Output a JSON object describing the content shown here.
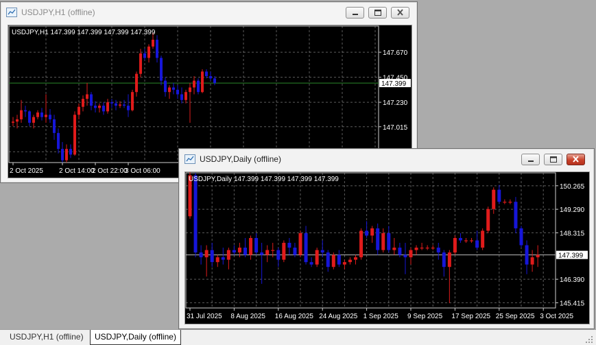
{
  "colors": {
    "bull": "#e01b1b",
    "bear": "#1616d8",
    "grid": "#a8a8a8",
    "text": "#ffffff",
    "price_line": "#2a8a2a",
    "background": "#000000"
  },
  "icons": {
    "window": "chart-window-icon",
    "minimize": "minimize-icon",
    "maximize": "maximize-icon",
    "close": "close-icon"
  },
  "window1": {
    "title": "USDJPY,H1 (offline)",
    "chart_label": "USDJPY,H1  147.399 147.399 147.399 147.399"
  },
  "window2": {
    "title": "USDJPY,Daily (offline)",
    "chart_label": "USDJPY,Daily  147.399 147.399 147.399 147.399"
  },
  "tabs": [
    {
      "label": "USDJPY,H1 (offline)",
      "active": false
    },
    {
      "label": "USDJPY,Daily (offline)",
      "active": true
    }
  ],
  "chart_data": [
    {
      "type": "candlestick",
      "symbol": "USDJPY",
      "timeframe": "H1",
      "ylim": [
        146.7,
        147.9
      ],
      "y_ticks": [
        "147.670",
        "147.450",
        "147.230",
        "147.015",
        "146.795"
      ],
      "y_tick_values": [
        147.67,
        147.45,
        147.23,
        147.015,
        146.795
      ],
      "x_ticks": [
        "2 Oct 2025",
        "2 Oct 14:00",
        "2 Oct 22:00",
        "3 Oct 06:00"
      ],
      "x_tick_index": [
        0,
        12,
        20,
        28
      ],
      "current_price": 147.399,
      "current_price_label": "147.399",
      "grid": true,
      "candles": [
        [
          147.05,
          147.1,
          147.02,
          147.06
        ],
        [
          147.06,
          147.12,
          147.0,
          147.08
        ],
        [
          147.08,
          147.25,
          147.05,
          147.16
        ],
        [
          147.16,
          147.2,
          147.1,
          147.15
        ],
        [
          147.15,
          147.16,
          147.02,
          147.05
        ],
        [
          147.05,
          147.12,
          147.0,
          147.1
        ],
        [
          147.1,
          147.16,
          147.08,
          147.14
        ],
        [
          147.14,
          147.18,
          147.07,
          147.1
        ],
        [
          147.1,
          147.3,
          147.05,
          147.12
        ],
        [
          147.12,
          147.17,
          147.05,
          147.08
        ],
        [
          147.08,
          147.12,
          146.9,
          146.96
        ],
        [
          146.96,
          147.0,
          146.78,
          146.82
        ],
        [
          146.82,
          146.88,
          146.68,
          146.72
        ],
        [
          146.72,
          146.86,
          146.7,
          146.82
        ],
        [
          146.82,
          146.86,
          146.74,
          146.77
        ],
        [
          146.77,
          147.15,
          146.76,
          147.12
        ],
        [
          147.12,
          147.22,
          147.08,
          147.19
        ],
        [
          147.19,
          147.29,
          147.15,
          147.26
        ],
        [
          147.26,
          147.4,
          147.2,
          147.3
        ],
        [
          147.3,
          147.32,
          147.16,
          147.2
        ],
        [
          147.2,
          147.24,
          147.14,
          147.18
        ],
        [
          147.18,
          147.22,
          147.14,
          147.2
        ],
        [
          147.2,
          147.23,
          147.12,
          147.15
        ],
        [
          147.15,
          147.26,
          147.13,
          147.23
        ],
        [
          147.23,
          147.26,
          147.18,
          147.22
        ],
        [
          147.22,
          147.25,
          147.16,
          147.2
        ],
        [
          147.2,
          147.24,
          147.18,
          147.21
        ],
        [
          147.21,
          147.25,
          147.18,
          147.2
        ],
        [
          147.2,
          147.3,
          147.1,
          147.16
        ],
        [
          147.16,
          147.34,
          147.15,
          147.32
        ],
        [
          147.32,
          147.5,
          147.28,
          147.48
        ],
        [
          147.48,
          147.7,
          147.45,
          147.66
        ],
        [
          147.66,
          147.7,
          147.6,
          147.62
        ],
        [
          147.62,
          147.74,
          147.58,
          147.72
        ],
        [
          147.72,
          147.84,
          147.7,
          147.78
        ],
        [
          147.78,
          147.82,
          147.58,
          147.62
        ],
        [
          147.62,
          147.64,
          147.38,
          147.42
        ],
        [
          147.42,
          147.45,
          147.28,
          147.32
        ],
        [
          147.32,
          147.38,
          147.26,
          147.36
        ],
        [
          147.36,
          147.4,
          147.3,
          147.34
        ],
        [
          147.34,
          147.38,
          147.26,
          147.3
        ],
        [
          147.3,
          147.36,
          147.22,
          147.25
        ],
        [
          147.25,
          147.34,
          147.22,
          147.32
        ],
        [
          147.32,
          147.4,
          147.05,
          147.36
        ],
        [
          147.36,
          147.46,
          147.3,
          147.42
        ],
        [
          147.42,
          147.44,
          147.3,
          147.32
        ],
        [
          147.32,
          147.52,
          147.31,
          147.5
        ],
        [
          147.5,
          147.52,
          147.44,
          147.46
        ],
        [
          147.46,
          147.5,
          147.42,
          147.44
        ],
        [
          147.44,
          147.46,
          147.38,
          147.4
        ]
      ]
    },
    {
      "type": "candlestick",
      "symbol": "USDJPY",
      "timeframe": "Daily",
      "ylim": [
        145.2,
        150.8
      ],
      "y_ticks": [
        "150.265",
        "149.290",
        "148.315",
        "146.390",
        "145.415"
      ],
      "y_tick_values": [
        150.265,
        149.29,
        148.315,
        146.39,
        145.415
      ],
      "x_ticks": [
        "31 Jul 2025",
        "8 Aug 2025",
        "16 Aug 2025",
        "24 Aug 2025",
        "1 Sep 2025",
        "9 Sep 2025",
        "17 Sep 2025",
        "25 Sep 2025",
        "3 Oct 2025"
      ],
      "x_tick_index": [
        0,
        8,
        16,
        24,
        32,
        40,
        48,
        56,
        64
      ],
      "current_price": 147.399,
      "current_price_label": "147.399",
      "grid": true,
      "candles": [
        [
          149.0,
          150.9,
          148.9,
          150.7
        ],
        [
          150.7,
          150.8,
          147.3,
          147.5
        ],
        [
          147.5,
          147.8,
          147.0,
          147.3
        ],
        [
          147.3,
          147.8,
          146.5,
          147.6
        ],
        [
          147.6,
          147.9,
          146.9,
          147.1
        ],
        [
          147.1,
          147.4,
          146.9,
          147.3
        ],
        [
          147.3,
          147.7,
          147.0,
          147.2
        ],
        [
          147.2,
          147.7,
          146.8,
          147.6
        ],
        [
          147.6,
          147.8,
          147.4,
          147.5
        ],
        [
          147.5,
          147.9,
          147.3,
          147.7
        ],
        [
          147.7,
          148.1,
          147.3,
          147.4
        ],
        [
          147.4,
          148.2,
          147.2,
          148.1
        ],
        [
          148.1,
          148.3,
          147.4,
          147.5
        ],
        [
          147.5,
          147.9,
          146.2,
          147.4
        ],
        [
          147.4,
          147.8,
          147.1,
          147.6
        ],
        [
          147.6,
          147.9,
          147.3,
          147.6
        ],
        [
          147.6,
          147.7,
          146.9,
          147.2
        ],
        [
          147.2,
          148.0,
          147.1,
          147.9
        ],
        [
          147.9,
          148.1,
          147.4,
          147.7
        ],
        [
          147.7,
          147.9,
          147.3,
          147.4
        ],
        [
          147.4,
          148.4,
          147.3,
          148.3
        ],
        [
          148.3,
          148.6,
          147.0,
          147.1
        ],
        [
          147.1,
          147.3,
          146.9,
          147.0
        ],
        [
          147.0,
          147.7,
          146.9,
          147.6
        ],
        [
          147.6,
          148.0,
          147.3,
          147.5
        ],
        [
          147.5,
          147.6,
          146.7,
          146.9
        ],
        [
          146.9,
          147.5,
          146.8,
          147.4
        ],
        [
          147.4,
          147.6,
          146.9,
          147.0
        ],
        [
          147.0,
          147.2,
          146.8,
          147.1
        ],
        [
          147.1,
          147.3,
          147.0,
          147.2
        ],
        [
          147.2,
          147.4,
          147.0,
          147.3
        ],
        [
          147.3,
          148.5,
          147.2,
          148.4
        ],
        [
          148.4,
          148.8,
          148.1,
          148.2
        ],
        [
          148.2,
          148.6,
          147.9,
          148.5
        ],
        [
          148.5,
          148.7,
          147.4,
          147.6
        ],
        [
          147.6,
          148.5,
          147.5,
          148.3
        ],
        [
          148.3,
          148.6,
          147.5,
          147.6
        ],
        [
          147.6,
          148.1,
          147.4,
          147.7
        ],
        [
          147.7,
          147.9,
          147.3,
          147.4
        ],
        [
          147.4,
          147.9,
          146.6,
          147.3
        ],
        [
          147.3,
          147.7,
          147.0,
          147.6
        ],
        [
          147.6,
          147.8,
          147.4,
          147.7
        ],
        [
          147.7,
          147.9,
          147.6,
          147.7
        ],
        [
          147.7,
          147.8,
          147.6,
          147.7
        ],
        [
          147.7,
          147.8,
          147.6,
          147.7
        ],
        [
          147.7,
          147.9,
          147.2,
          147.5
        ],
        [
          147.5,
          147.6,
          146.5,
          146.9
        ],
        [
          146.9,
          147.6,
          145.4,
          147.5
        ],
        [
          147.5,
          148.2,
          147.4,
          148.1
        ],
        [
          148.1,
          148.3,
          147.9,
          148.0
        ],
        [
          148.0,
          148.1,
          147.9,
          148.0
        ],
        [
          148.0,
          148.1,
          147.9,
          148.0
        ],
        [
          148.0,
          148.4,
          147.6,
          147.7
        ],
        [
          147.7,
          148.5,
          147.6,
          148.4
        ],
        [
          148.4,
          149.4,
          148.3,
          149.3
        ],
        [
          149.3,
          150.2,
          149.1,
          150.1
        ],
        [
          150.1,
          150.3,
          149.5,
          149.6
        ],
        [
          149.6,
          149.7,
          149.5,
          149.6
        ],
        [
          149.6,
          149.7,
          149.5,
          149.6
        ],
        [
          149.6,
          149.8,
          148.3,
          148.5
        ],
        [
          148.5,
          148.6,
          147.7,
          147.8
        ],
        [
          147.8,
          148.0,
          146.6,
          147.0
        ],
        [
          147.0,
          147.6,
          146.7,
          147.3
        ],
        [
          147.3,
          147.8,
          146.9,
          147.4
        ]
      ]
    }
  ]
}
